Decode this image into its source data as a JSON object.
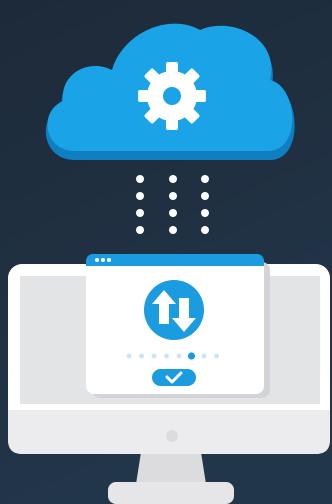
{
  "colors": {
    "background": "#1f2c3b",
    "background_light": "#22364a",
    "cloud_main": "#1aa3e6",
    "cloud_shadow": "#0f7fc2",
    "gear": "#ffffff",
    "dots": "#ffffff",
    "monitor_bezel": "#ffffff",
    "monitor_screen": "#e3e4e6",
    "monitor_chin": "#ececee",
    "stand": "#dcdcdf",
    "window_header": "#1b9be0",
    "window_body": "#ffffff",
    "window_shadow": "#dadbdd",
    "sync_circle": "#1b9be0",
    "progress_active": "#1b9be0",
    "progress_inactive": "#c9e5f6",
    "check_button": "#1b9be0"
  },
  "icons": {
    "cloud": "cloud-icon",
    "gear": "gear-icon",
    "sync": "up-down-arrows-icon",
    "check": "checkmark-icon",
    "monitor": "desktop-monitor-icon"
  },
  "progress": {
    "total_dots": 8,
    "active_index": 5
  },
  "data_stream": {
    "columns": 3,
    "rows": 4
  }
}
